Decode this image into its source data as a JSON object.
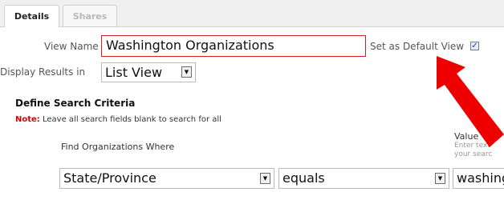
{
  "tabs": [
    {
      "label": "Details"
    },
    {
      "label": "Shares"
    }
  ],
  "view_name": {
    "label": "View Name",
    "value": "Washington Organizations"
  },
  "default_view": {
    "label": "Set as Default View",
    "checked": true,
    "check_glyph": "✓"
  },
  "display_results": {
    "label": "Display Results in",
    "selected": "List View"
  },
  "criteria": {
    "heading": "Define Search Criteria",
    "note_key": "Note:",
    "note_text": " Leave all search fields blank to search for all",
    "find_label": "Find Organizations Where",
    "value_label": "Value",
    "value_hint_1": "Enter text",
    "value_hint_2": "your searc",
    "field_selected": "State/Province",
    "operator_selected": "equals",
    "value_text": "washing"
  },
  "icons": {
    "dropdown": "▼",
    "annotation_arrow": "red-arrow-icon"
  },
  "colors": {
    "highlight_border": "#d02020",
    "note_red": "#e00000",
    "arrow_red": "#ee0000"
  }
}
